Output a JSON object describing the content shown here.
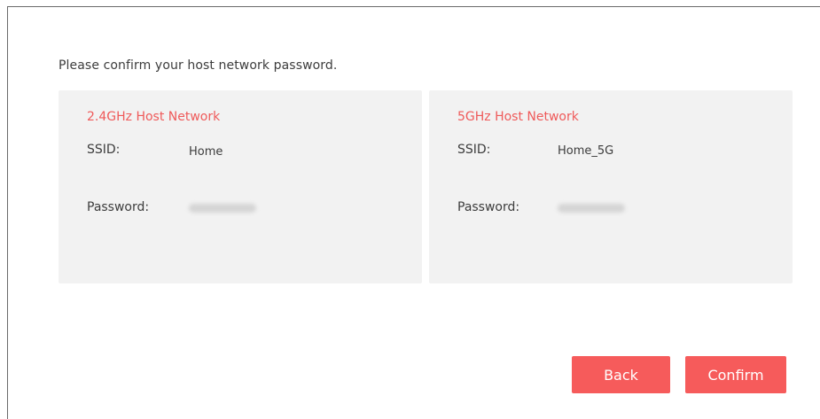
{
  "dialog": {
    "prompt": "Please confirm your host network password."
  },
  "networks": [
    {
      "title": "2.4GHz Host Network",
      "ssid_label": "SSID:",
      "ssid_value": "Home",
      "password_label": "Password:"
    },
    {
      "title": "5GHz Host Network",
      "ssid_label": "SSID:",
      "ssid_value": "Home_5G",
      "password_label": "Password:"
    }
  ],
  "buttons": {
    "back": "Back",
    "confirm": "Confirm"
  },
  "colors": {
    "accent": "#f65b5b",
    "title": "#ef5a5a",
    "card_bg": "#f2f2f2"
  }
}
